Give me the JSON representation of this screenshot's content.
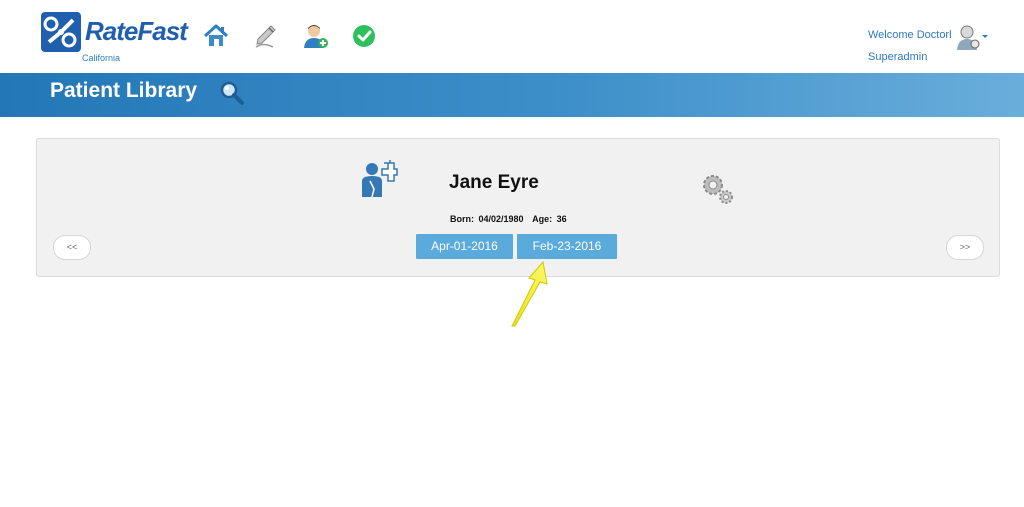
{
  "header": {
    "brand": {
      "rate": "Rate",
      "fast": "Fast",
      "region": "California"
    },
    "nav_icons": [
      "home-icon",
      "edit-pen-icon",
      "add-patient-icon",
      "check-circle-icon"
    ],
    "welcome_text": "Welcome Doctorl",
    "role_text": "Superadmin",
    "user_icon": "doctor-user-icon"
  },
  "page": {
    "title": "Patient Library",
    "search_icon": "magnifier-icon"
  },
  "patient": {
    "name": "Jane Eyre",
    "born_label": "Born:",
    "born_value": "04/02/1980",
    "age_label": "Age:",
    "age_value": "36",
    "prev_label": "<<",
    "next_label": ">>",
    "visit_dates": [
      "Apr-01-2016",
      "Feb-23-2016"
    ]
  },
  "colors": {
    "brand_blue": "#1f5fae",
    "band_start": "#2377b6",
    "band_end": "#6aaedb",
    "date_button": "#5aaadc",
    "annotation_arrow": "#f2ef2a"
  }
}
